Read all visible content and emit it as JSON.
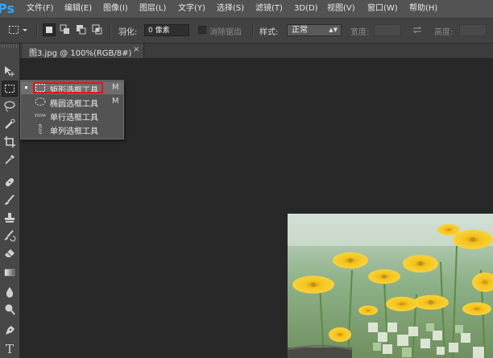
{
  "app": {
    "logo": "Ps"
  },
  "menu": [
    {
      "label": "文件(F)"
    },
    {
      "label": "编辑(E)"
    },
    {
      "label": "图像(I)"
    },
    {
      "label": "图层(L)"
    },
    {
      "label": "文字(Y)"
    },
    {
      "label": "选择(S)"
    },
    {
      "label": "滤镜(T)"
    },
    {
      "label": "3D(D)"
    },
    {
      "label": "视图(V)"
    },
    {
      "label": "窗口(W)"
    },
    {
      "label": "帮助(H)"
    }
  ],
  "options": {
    "feather_label": "羽化:",
    "feather_value": "0 像素",
    "antialias_label": "消除锯齿",
    "style_label": "样式:",
    "style_value": "正常",
    "width_label": "宽度:",
    "height_label": "高度:"
  },
  "document_tab": {
    "title": "图3.jpg @ 100%(RGB/8#)",
    "close": "×"
  },
  "flyout": {
    "items": [
      {
        "label": "矩形选框工具",
        "shortcut": "M",
        "icon": "rect-marquee-icon",
        "selected": true
      },
      {
        "label": "椭圆选框工具",
        "shortcut": "M",
        "icon": "elliptical-marquee-icon",
        "selected": false
      },
      {
        "label": "单行选框工具",
        "shortcut": "",
        "icon": "single-row-marquee-icon",
        "selected": false
      },
      {
        "label": "单列选框工具",
        "shortcut": "",
        "icon": "single-column-marquee-icon",
        "selected": false
      }
    ],
    "highlight_color": "#e3131b"
  },
  "tools": [
    "move-tool-icon",
    "marquee-tool-icon",
    "lasso-tool-icon",
    "quick-selection-icon",
    "crop-tool-icon",
    "eyedropper-icon",
    "spot-healing-icon",
    "brush-tool-icon",
    "clone-stamp-icon",
    "history-brush-icon",
    "eraser-icon",
    "gradient-icon",
    "blur-tool-icon",
    "dodge-tool-icon",
    "pen-tool-icon",
    "type-tool-icon"
  ],
  "colors": {
    "menubar": "#535353",
    "options": "#424242",
    "canvas": "#282828",
    "accent": "#31a8ff"
  }
}
